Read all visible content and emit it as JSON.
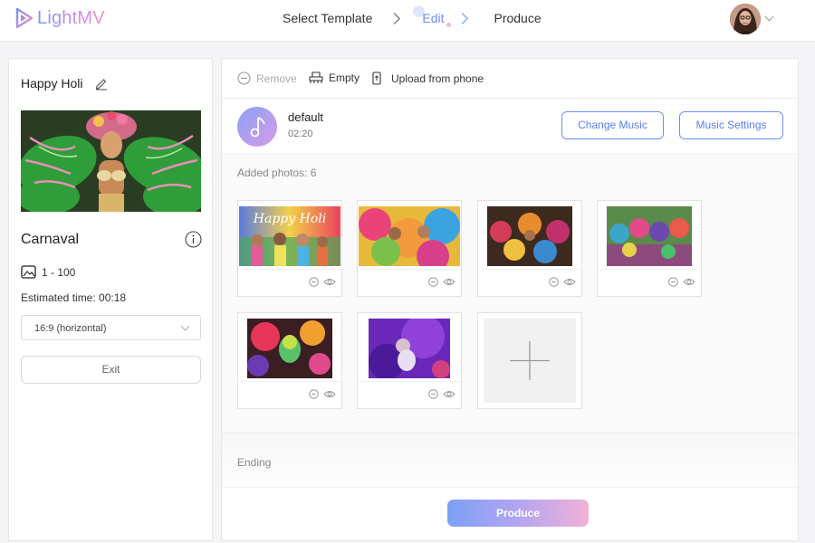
{
  "app": {
    "name": "LightMV"
  },
  "steps": [
    {
      "label": "Select Template"
    },
    {
      "label": "Edit"
    },
    {
      "label": "Produce"
    }
  ],
  "left_panel": {
    "project_title": "Happy Holi",
    "template_name": "Carnaval",
    "photo_range": "1 - 100",
    "estimated_time": "Estimated time: 00:18",
    "ratio_selected": "16:9 (horizontal)",
    "exit_label": "Exit"
  },
  "toolbar": {
    "remove_label": "Remove",
    "empty_label": "Empty",
    "upload_label": "Upload from phone"
  },
  "music": {
    "name": "default",
    "duration": "02:20",
    "change_label": "Change Music",
    "settings_label": "Music Settings"
  },
  "photos": {
    "added_label": "Added photos: 6",
    "items": [
      {
        "caption": "Happy Holi"
      },
      {
        "caption": ""
      },
      {
        "caption": ""
      },
      {
        "caption": ""
      },
      {
        "caption": ""
      },
      {
        "caption": ""
      }
    ]
  },
  "ending": {
    "label": "Ending"
  },
  "produce": {
    "label": "Produce"
  },
  "colors": {
    "accent": "#6c8ef5",
    "gradient_start": "#7d9ff6",
    "gradient_end": "#f2b1d6"
  },
  "icons": [
    "logo-icon",
    "chevron-right-icon",
    "avatar",
    "chevron-down-icon",
    "edit-icon",
    "info-icon",
    "image-icon",
    "remove-icon",
    "empty-icon",
    "phone-icon",
    "music-note-icon",
    "eye-icon",
    "plus-icon"
  ]
}
